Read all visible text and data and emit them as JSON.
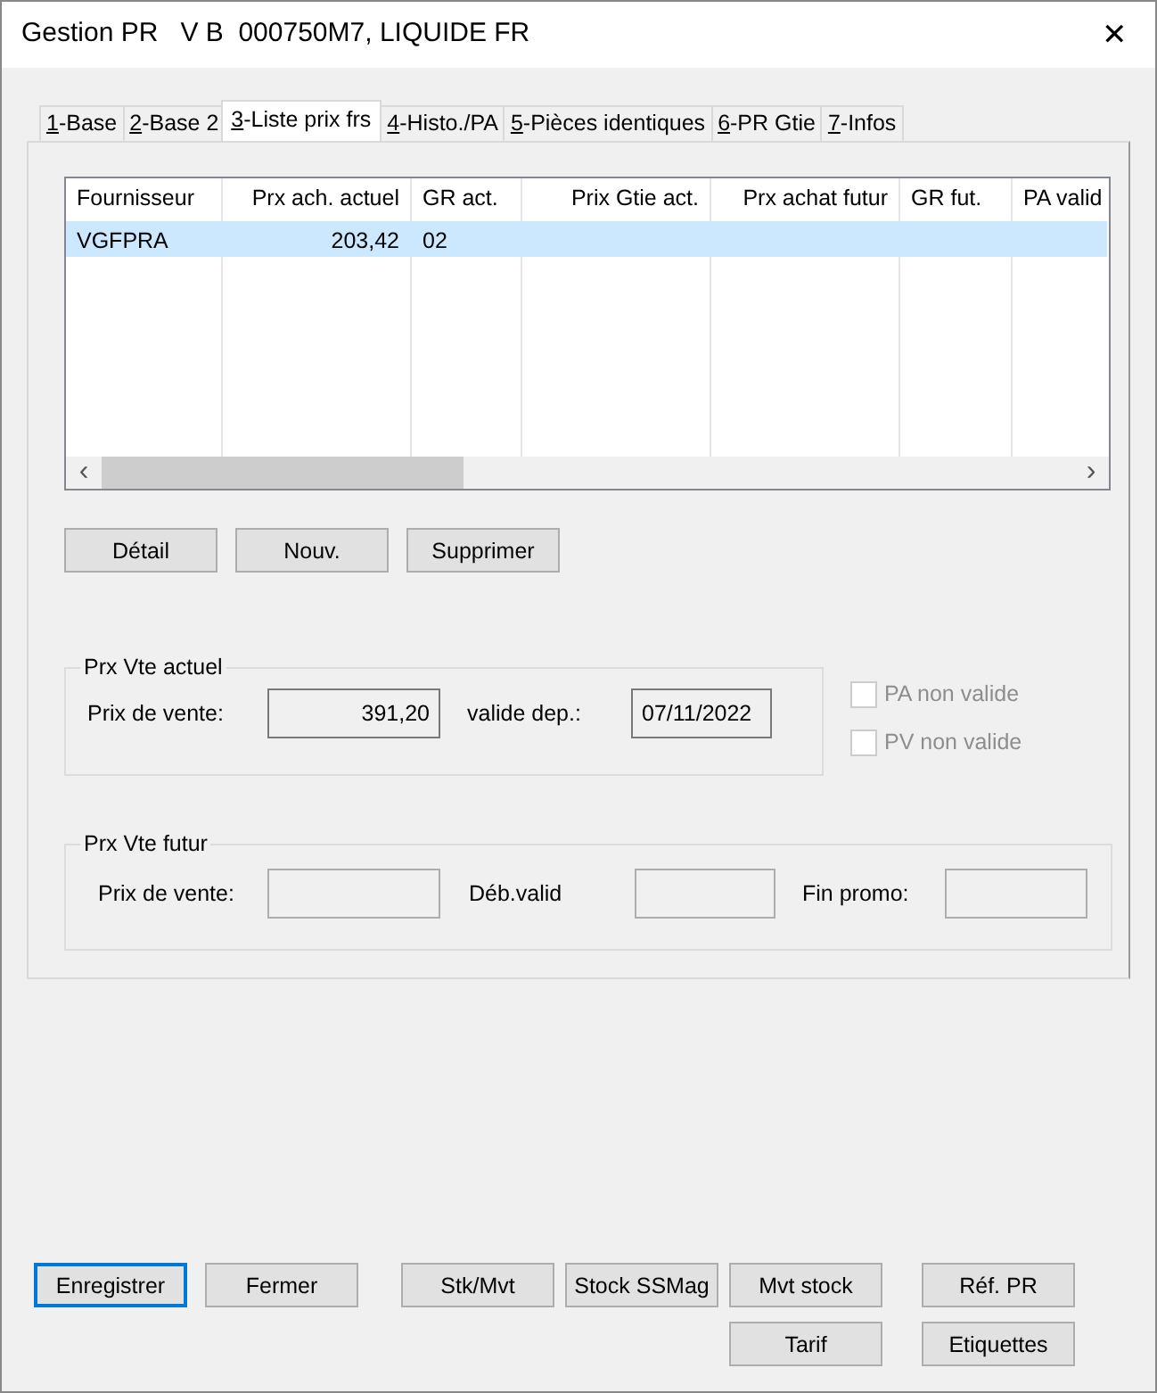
{
  "window": {
    "title": "Gestion PR   V B  000750M7, LIQUIDE FR",
    "close": "✕"
  },
  "tabs": [
    {
      "label": "1-Base",
      "selected": false
    },
    {
      "label": "2-Base 2",
      "selected": false
    },
    {
      "label": "3-Liste prix frs",
      "selected": true
    },
    {
      "label": "4-Histo./PA",
      "selected": false
    },
    {
      "label": "5-Pièces identiques",
      "selected": false
    },
    {
      "label": "6-PR Gtie",
      "selected": false
    },
    {
      "label": "7-Infos",
      "selected": false
    }
  ],
  "table": {
    "columns": [
      {
        "label": "Fournisseur"
      },
      {
        "label": "Prx ach. actuel"
      },
      {
        "label": "GR act."
      },
      {
        "label": "Prix Gtie act."
      },
      {
        "label": "Prx achat futur"
      },
      {
        "label": "GR fut."
      },
      {
        "label": "PA valid"
      }
    ],
    "rows": [
      {
        "cells": [
          "VGFPRA",
          "203,42",
          "02"
        ],
        "selected": true
      }
    ],
    "scroll_left": "‹",
    "scroll_right": "›"
  },
  "list_buttons": [
    {
      "label": "Détail"
    },
    {
      "label": "Nouv."
    },
    {
      "label": "Supprimer"
    }
  ],
  "current_price": {
    "title": "Prx Vte actuel",
    "price_label": "Prix de vente:",
    "price": "391,20",
    "date_label": "valide dep.:",
    "date": "07/11/2022"
  },
  "flags": [
    {
      "label": "PA non valide",
      "checked": false,
      "disabled": true
    },
    {
      "label": "PV non valide",
      "checked": false,
      "disabled": true
    }
  ],
  "future_price": {
    "title": "Prx Vte futur",
    "price_label": "Prix de vente:",
    "start_label": "Déb.valid",
    "end_label": "Fin promo:"
  },
  "footer_buttons": [
    [
      {
        "label": "Enregistrer",
        "focused": true
      },
      {
        "label": "Fermer",
        "focused": false
      },
      {
        "label": "Stk/Mvt",
        "focused": false
      },
      {
        "label": "Stock SSMag",
        "focused": false
      },
      {
        "label": "Mvt stock",
        "focused": false
      },
      {
        "label": "Réf. PR",
        "focused": false
      }
    ],
    [
      {
        "label": "Tarif",
        "focused": false
      },
      {
        "label": "Etiquettes",
        "focused": false
      }
    ]
  ]
}
